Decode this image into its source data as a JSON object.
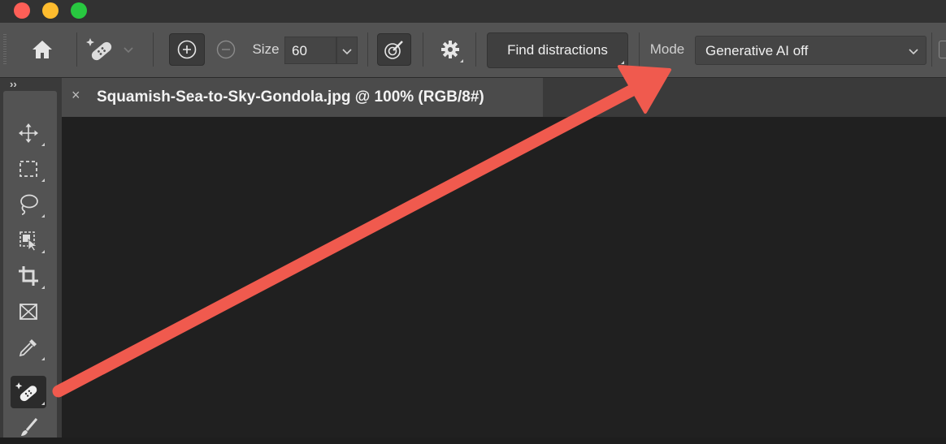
{
  "window": {
    "traffic_lights": {
      "close": "#fe5f57",
      "minimize": "#febc2e",
      "zoom": "#28c840"
    }
  },
  "options_bar": {
    "size_label": "Size",
    "size_value": "60",
    "find_distractions_label": "Find distractions",
    "mode_label": "Mode",
    "mode_value": "Generative AI off"
  },
  "toolbar": {
    "collapse_glyph": "››",
    "tools": [
      "move-tool",
      "rectangular-marquee-tool",
      "lasso-tool",
      "object-selection-tool",
      "crop-tool",
      "frame-tool",
      "eyedropper-tool",
      "remove-tool",
      "brush-tool"
    ],
    "active_tool": "remove-tool"
  },
  "document": {
    "close_glyph": "×",
    "tab_title": "Squamish-Sea-to-Sky-Gondola.jpg @ 100% (RGB/8#)"
  },
  "annotation": {
    "arrow_color": "#f05a4e",
    "arrow_from": "remove-tool",
    "arrow_to": "mode-dropdown"
  }
}
